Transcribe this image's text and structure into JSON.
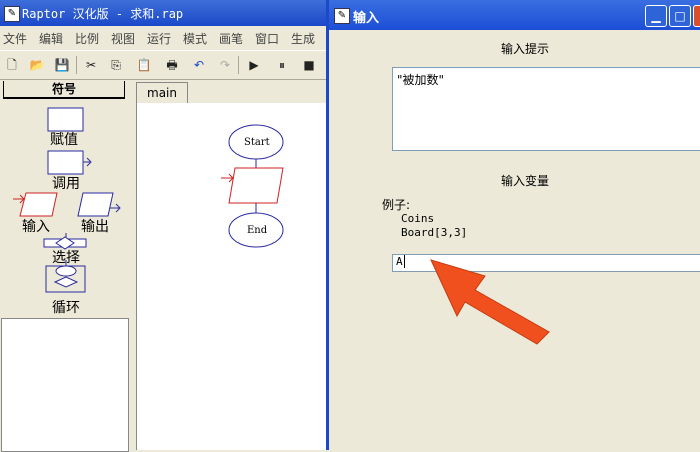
{
  "main_window": {
    "title": "Raptor 汉化版 - 求和.rap",
    "menu": [
      "文件",
      "编辑",
      "比例",
      "视图",
      "运行",
      "模式",
      "画笔",
      "窗口",
      "生成"
    ],
    "symbols_header": "符号",
    "symbols": {
      "assign": "赋值",
      "call": "调用",
      "input": "输入",
      "output": "输出",
      "select": "选择",
      "loop": "循环"
    },
    "tab": "main",
    "flowchart": {
      "start": "Start",
      "end": "End"
    }
  },
  "dialog": {
    "title": "输入",
    "prompt_label": "输入提示",
    "prompt_value": "\"被加数\"",
    "variable_label": "输入变量",
    "example_label": "例子:",
    "examples": [
      "Coins",
      "Board[3,3]"
    ],
    "variable_value": "A"
  },
  "colors": {
    "titlebar": "#1c48c9",
    "symbol_blue": "#2a2aa0",
    "input_red": "#cc2222",
    "arrow": "#f0501e"
  }
}
